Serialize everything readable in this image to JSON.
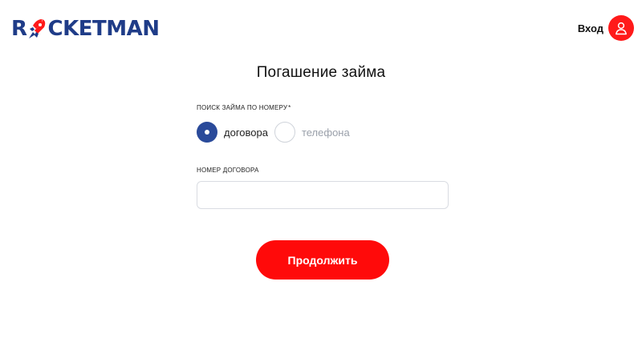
{
  "header": {
    "logo": {
      "letter_r": "R",
      "rest": "CKETMAN",
      "primary_color": "#1f3c88",
      "accent_color": "#ff1a1a"
    },
    "login_label": "Вход",
    "avatar_icon": "user-icon"
  },
  "page": {
    "title": "Погашение займа"
  },
  "form": {
    "search_label": "Поиск займа по номеру",
    "required_mark": "*",
    "radio_options": [
      {
        "label": "договора",
        "selected": true
      },
      {
        "label": "телефона",
        "selected": false
      }
    ],
    "contract_label": "Номер договора",
    "contract_value": "",
    "contract_placeholder": "",
    "submit_label": "Продолжить"
  },
  "colors": {
    "accent": "#ff0a0a",
    "radio_selected": "#2a4a9a"
  }
}
